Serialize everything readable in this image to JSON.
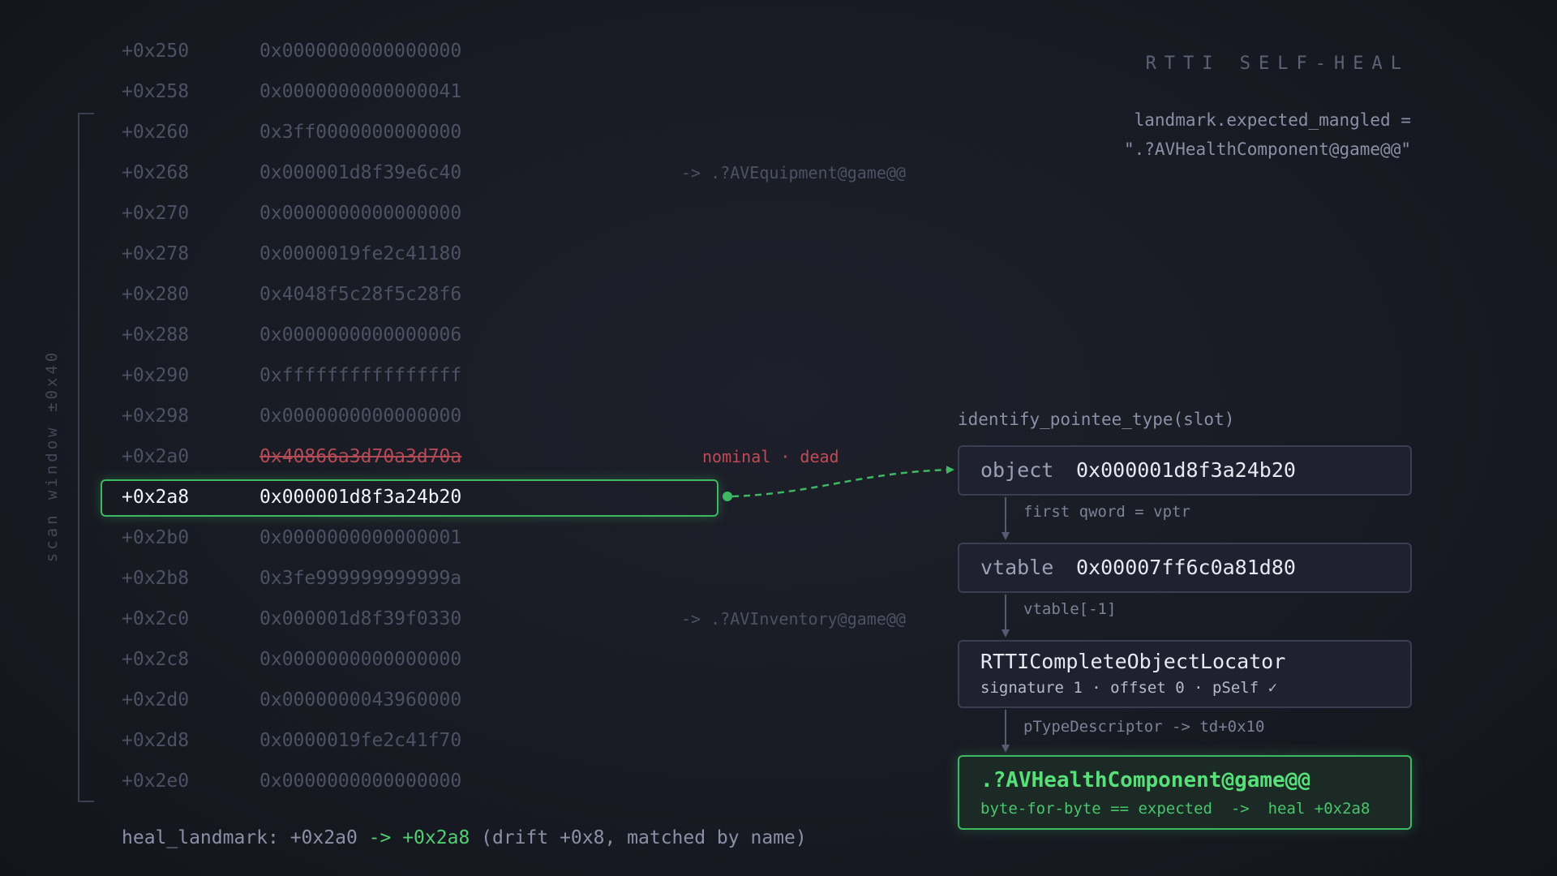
{
  "title": "RTTI SELF-HEAL",
  "landmark": {
    "line1": "landmark.expected_mangled =",
    "line2": "\".?AVHealthComponent@game@@\""
  },
  "scan_window_label": "scan window ±0x40",
  "rows": [
    {
      "offset": "+0x250",
      "value": "0x0000000000000000",
      "note": ""
    },
    {
      "offset": "+0x258",
      "value": "0x0000000000000041",
      "note": ""
    },
    {
      "offset": "+0x260",
      "value": "0x3ff0000000000000",
      "note": ""
    },
    {
      "offset": "+0x268",
      "value": "0x000001d8f39e6c40",
      "note": "-> .?AVEquipment@game@@"
    },
    {
      "offset": "+0x270",
      "value": "0x0000000000000000",
      "note": ""
    },
    {
      "offset": "+0x278",
      "value": "0x0000019fe2c41180",
      "note": ""
    },
    {
      "offset": "+0x280",
      "value": "0x4048f5c28f5c28f6",
      "note": ""
    },
    {
      "offset": "+0x288",
      "value": "0x0000000000000006",
      "note": ""
    },
    {
      "offset": "+0x290",
      "value": "0xffffffffffffffff",
      "note": ""
    },
    {
      "offset": "+0x298",
      "value": "0x0000000000000000",
      "note": ""
    },
    {
      "offset": "+0x2a0",
      "value": "0x40866a3d70a3d70a",
      "note": "nominal · dead"
    },
    {
      "offset": "+0x2a8",
      "value": "0x000001d8f3a24b20",
      "note": ""
    },
    {
      "offset": "+0x2b0",
      "value": "0x0000000000000001",
      "note": ""
    },
    {
      "offset": "+0x2b8",
      "value": "0x3fe999999999999a",
      "note": ""
    },
    {
      "offset": "+0x2c0",
      "value": "0x000001d8f39f0330",
      "note": "-> .?AVInventory@game@@"
    },
    {
      "offset": "+0x2c8",
      "value": "0x0000000000000000",
      "note": ""
    },
    {
      "offset": "+0x2d0",
      "value": "0x0000000043960000",
      "note": ""
    },
    {
      "offset": "+0x2d8",
      "value": "0x0000019fe2c41f70",
      "note": ""
    },
    {
      "offset": "+0x2e0",
      "value": "0x0000000000000000",
      "note": ""
    }
  ],
  "identify_label": "identify_pointee_type(slot)",
  "object_box": {
    "key": "object",
    "value": "0x000001d8f3a24b20"
  },
  "conn1": "first qword = vptr",
  "vtable_box": {
    "key": "vtable",
    "value": "0x00007ff6c0a81d80"
  },
  "conn2": "vtable[-1]",
  "locator_box": {
    "title": "RTTICompleteObjectLocator",
    "sub": "signature 1 · offset 0 · pSelf ✓"
  },
  "conn3": "pTypeDescriptor -> td+0x10",
  "result_box": {
    "title": ".?AVHealthComponent@game@@",
    "sub": "byte-for-byte == expected  ->  heal +0x2a8"
  },
  "footer": {
    "prefix": "heal_landmark: +0x2a0 ",
    "arrow": "->",
    "space": " ",
    "target": "+0x2a8",
    "suffix": " (drift +0x8, matched by name)"
  },
  "colors": {
    "green": "#3fb862",
    "red": "#c04b57",
    "dim": "#4c5163"
  }
}
